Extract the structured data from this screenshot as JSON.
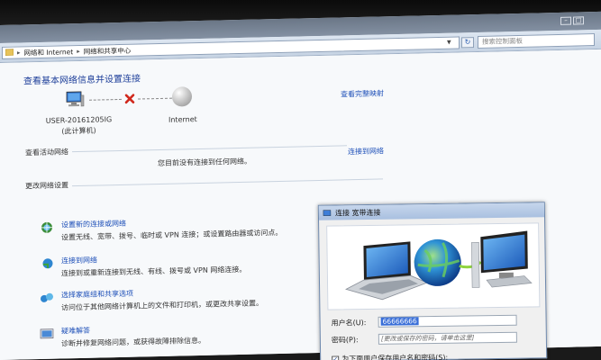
{
  "address_bar": {
    "crumbs": [
      "网络和 Internet",
      "网络和共享中心"
    ],
    "search_placeholder": "搜索控制面板"
  },
  "content": {
    "heading": "查看基本网络信息并设置连接",
    "see_full_map": "查看完整映射",
    "computer_name": "USER-20161205IG",
    "computer_sub": "(此计算机)",
    "internet_label": "Internet",
    "active_networks_label": "查看活动网络",
    "not_connected_text": "您目前没有连接到任何网络。",
    "connect_link": "连接到网络",
    "change_settings_label": "更改网络设置",
    "tasks": [
      {
        "link": "设置新的连接或网络",
        "desc": "设置无线、宽带、拨号、临时或 VPN 连接；或设置路由器或访问点。"
      },
      {
        "link": "连接到网络",
        "desc": "连接到或重新连接到无线、有线、拨号或 VPN 网络连接。"
      },
      {
        "link": "选择家庭组和共享选项",
        "desc": "访问位于其他网络计算机上的文件和打印机，或更改共享设置。"
      },
      {
        "link": "疑难解答",
        "desc": "诊断并修复网络问题，或获得故障排除信息。"
      }
    ]
  },
  "dialog": {
    "title": "连接 宽带连接",
    "username_label": "用户名(U):",
    "username_value": "66666666",
    "password_label": "密码(P):",
    "password_value": "[更改或保存的密码，请单击这里]",
    "save_checkbox_label": "为下面用户保存用户名和密码(S):"
  },
  "colors": {
    "link": "#1d4fb8",
    "heading": "#1e3f9a",
    "error_x": "#d0281c"
  }
}
